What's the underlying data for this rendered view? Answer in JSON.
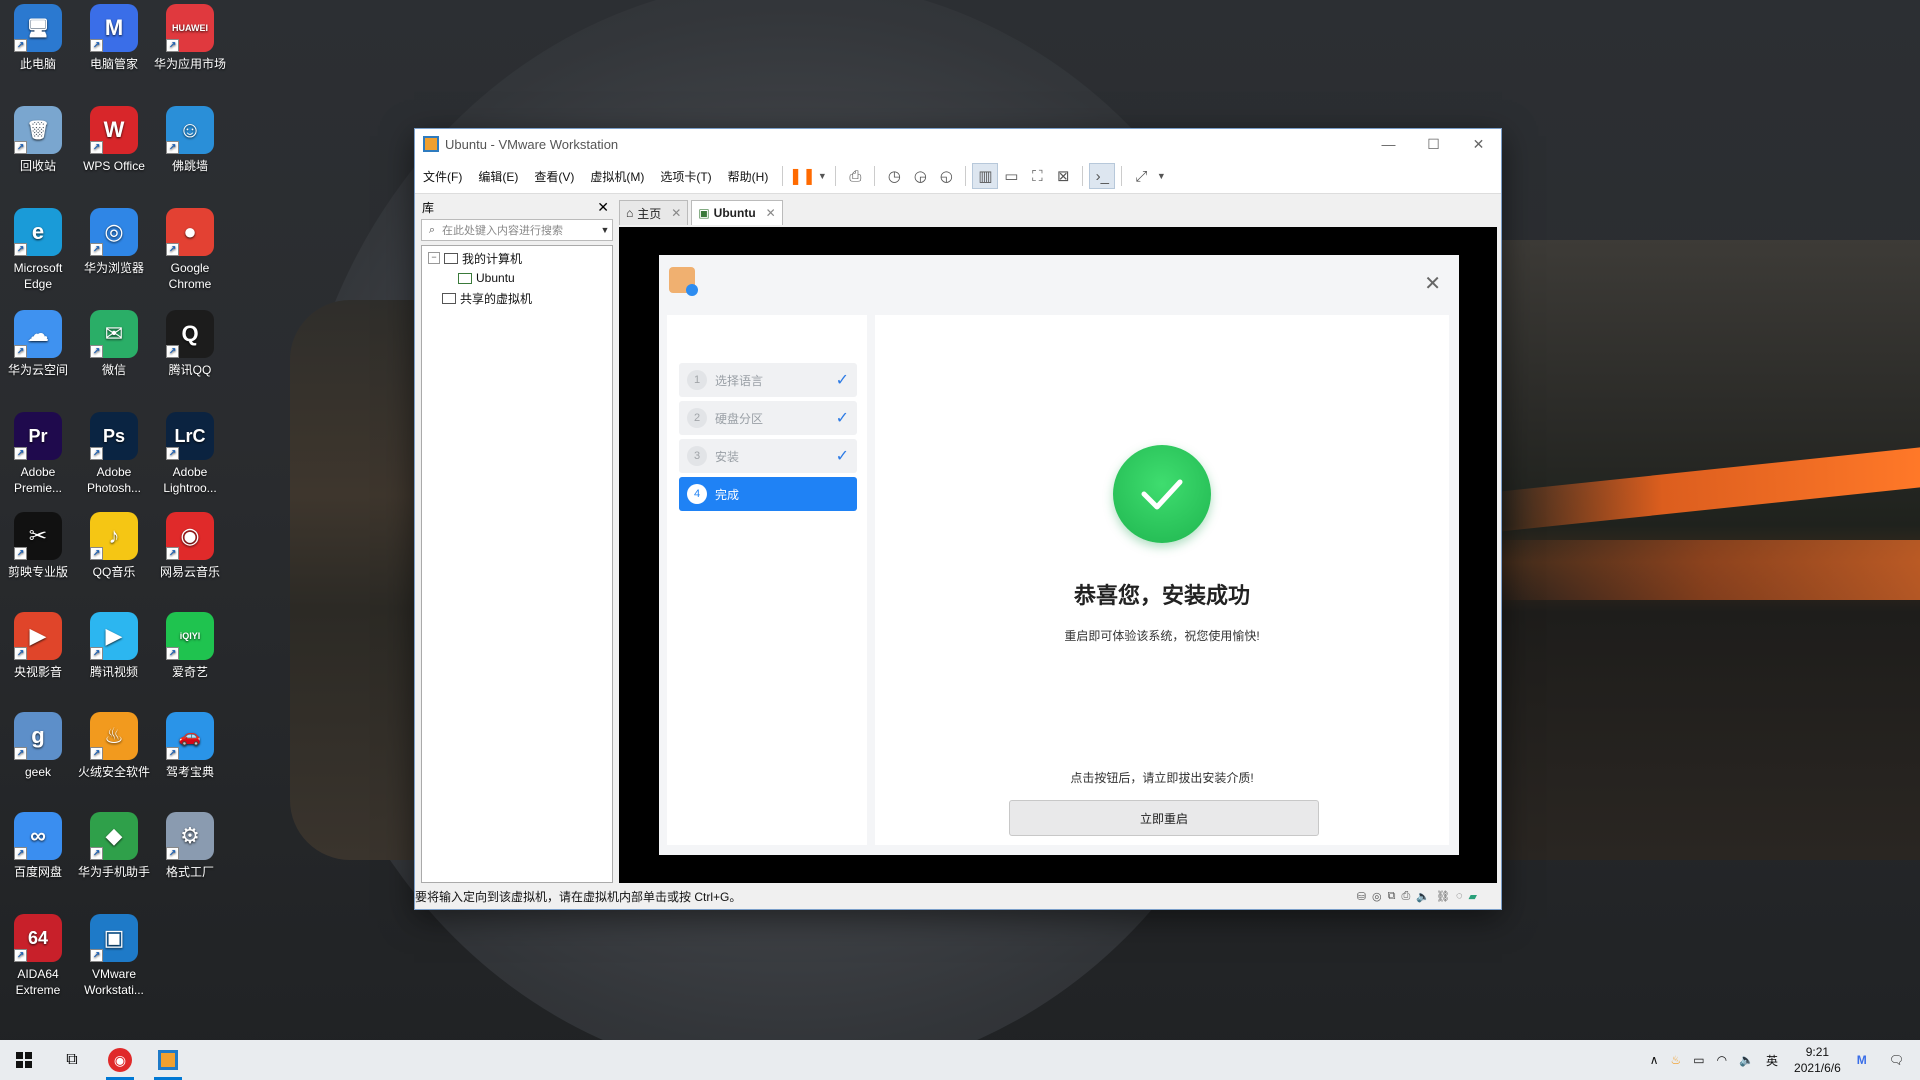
{
  "desktop": {
    "icons": [
      {
        "label": "此电脑",
        "glyph": "🖥",
        "color": "#2b79d0"
      },
      {
        "label": "电脑管家",
        "glyph": "M",
        "color": "#3a6ee8"
      },
      {
        "label": "华为应用市场",
        "glyph": "HUAWEI",
        "color": "#e0393e"
      },
      {
        "label": "回收站",
        "glyph": "🗑",
        "color": "#7aa6cf"
      },
      {
        "label": "WPS Office",
        "glyph": "W",
        "color": "#d8262a"
      },
      {
        "label": "佛跳墙",
        "glyph": "☺",
        "color": "#2a8fd8"
      },
      {
        "label": "Microsoft Edge",
        "glyph": "e",
        "color": "#1a9bd8"
      },
      {
        "label": "华为浏览器",
        "glyph": "◎",
        "color": "#2f86e6"
      },
      {
        "label": "Google Chrome",
        "glyph": "●",
        "color": "#e34133"
      },
      {
        "label": "华为云空间",
        "glyph": "☁",
        "color": "#3f92f0"
      },
      {
        "label": "微信",
        "glyph": "✉",
        "color": "#2aae67"
      },
      {
        "label": "腾讯QQ",
        "glyph": "Q",
        "color": "#1c1c1c"
      },
      {
        "label": "Adobe Premie...",
        "glyph": "Pr",
        "color": "#1f0a4d"
      },
      {
        "label": "Adobe Photosh...",
        "glyph": "Ps",
        "color": "#0a2442"
      },
      {
        "label": "Adobe Lightroo...",
        "glyph": "LrC",
        "color": "#0b2340"
      },
      {
        "label": "剪映专业版",
        "glyph": "✂",
        "color": "#111111"
      },
      {
        "label": "QQ音乐",
        "glyph": "♪",
        "color": "#f5c614"
      },
      {
        "label": "网易云音乐",
        "glyph": "◉",
        "color": "#e02a2a"
      },
      {
        "label": "央视影音",
        "glyph": "▶",
        "color": "#e0452a"
      },
      {
        "label": "腾讯视频",
        "glyph": "▶",
        "color": "#2cb6f0"
      },
      {
        "label": "爱奇艺",
        "glyph": "iQIYI",
        "color": "#1fc34f"
      },
      {
        "label": "geek",
        "glyph": "g",
        "color": "#5d8fc9"
      },
      {
        "label": "火绒安全软件",
        "glyph": "♨",
        "color": "#f29a1e"
      },
      {
        "label": "驾考宝典",
        "glyph": "🚗",
        "color": "#2a94e8"
      },
      {
        "label": "百度网盘",
        "glyph": "∞",
        "color": "#3a8ef0"
      },
      {
        "label": "华为手机助手",
        "glyph": "◆",
        "color": "#2fa04a"
      },
      {
        "label": "格式工厂",
        "glyph": "⚙",
        "color": "#8a9bb0"
      },
      {
        "label": "AIDA64 Extreme",
        "glyph": "64",
        "color": "#c8202a"
      },
      {
        "label": "VMware Workstati...",
        "glyph": "▣",
        "color": "#1e7ac8"
      }
    ]
  },
  "vmware": {
    "title": "Ubuntu - VMware Workstation",
    "menu": [
      "文件(F)",
      "编辑(E)",
      "查看(V)",
      "虚拟机(M)",
      "选项卡(T)",
      "帮助(H)"
    ],
    "library": {
      "title": "库",
      "search_placeholder": "在此处键入内容进行搜索",
      "tree": {
        "root": "我的计算机",
        "child": "Ubuntu",
        "shared": "共享的虚拟机"
      }
    },
    "tabs": [
      {
        "label": "主页"
      },
      {
        "label": "Ubuntu"
      }
    ],
    "status_text": "要将输入定向到该虚拟机，请在虚拟机内部单击或按 Ctrl+G。"
  },
  "installer": {
    "steps": [
      {
        "num": "1",
        "label": "选择语言",
        "done": true
      },
      {
        "num": "2",
        "label": "硬盘分区",
        "done": true
      },
      {
        "num": "3",
        "label": "安装",
        "done": true
      },
      {
        "num": "4",
        "label": "完成",
        "done": false
      }
    ],
    "title": "恭喜您，安装成功",
    "subtitle": "重启即可体验该系统，祝您使用愉快!",
    "hint": "点击按钮后，请立即拔出安装介质!",
    "button": "立即重启"
  },
  "taskbar": {
    "ime": "英",
    "time": "9:21",
    "date": "2021/6/6"
  }
}
